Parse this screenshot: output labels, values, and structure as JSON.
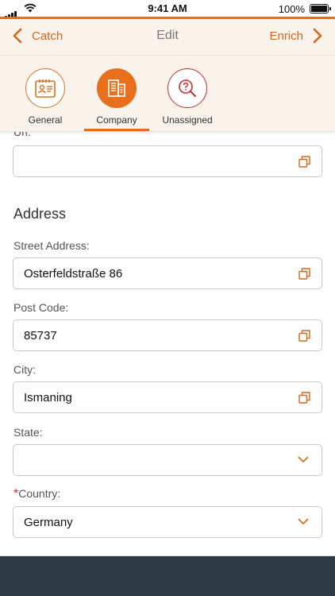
{
  "status": {
    "time": "9:41 AM",
    "battery": "100%"
  },
  "nav": {
    "back_label": "Catch",
    "title": "Edit",
    "next_label": "Enrich"
  },
  "tabs": [
    {
      "label": "General",
      "icon": "contact-card-icon"
    },
    {
      "label": "Company",
      "icon": "building-icon",
      "selected": true
    },
    {
      "label": "Unassigned",
      "icon": "question-search-icon"
    }
  ],
  "form": {
    "partial_label": "Url:",
    "url_value": "",
    "address_title": "Address",
    "street": {
      "label": "Street Address:",
      "value": "Osterfeldstraße 86"
    },
    "postcode": {
      "label": "Post Code:",
      "value": "85737"
    },
    "city": {
      "label": "City:",
      "value": "Ismaning"
    },
    "state": {
      "label": "State:",
      "value": ""
    },
    "country": {
      "label": "Country:",
      "value": "Germany",
      "required_mark": "*"
    }
  },
  "colors": {
    "accent": "#e0701c",
    "alert": "#c4302b",
    "bottom_bar": "#2f3a47"
  }
}
